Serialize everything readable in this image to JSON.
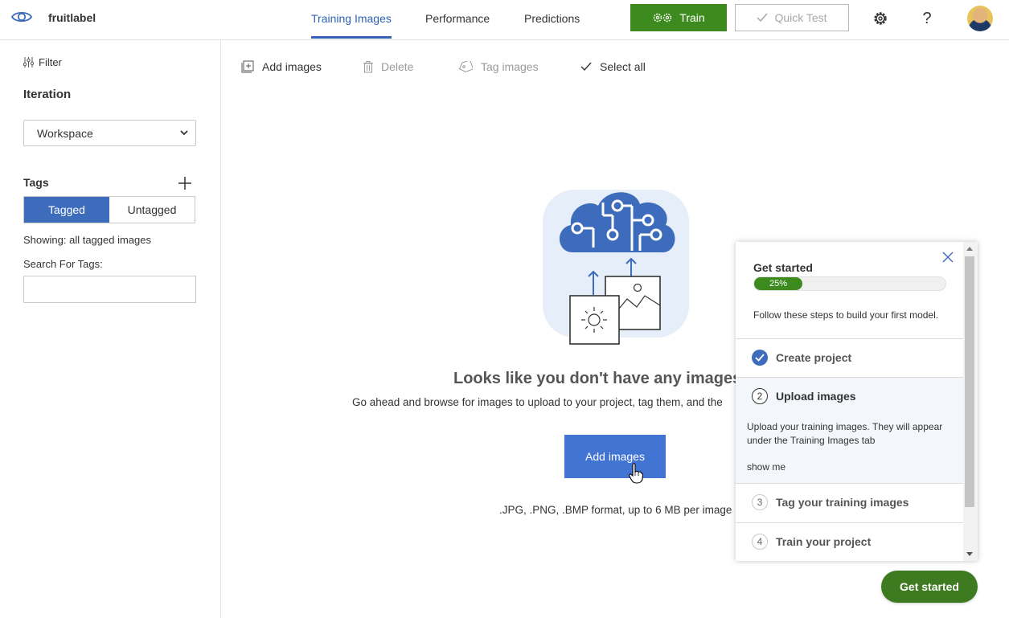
{
  "header": {
    "project_name": "fruitlabel",
    "tabs": [
      {
        "label": "Training Images",
        "active": true
      },
      {
        "label": "Performance",
        "active": false
      },
      {
        "label": "Predictions",
        "active": false
      }
    ],
    "train_label": "Train",
    "quick_test_label": "Quick Test",
    "help_label": "?"
  },
  "sidebar": {
    "filter_label": "Filter",
    "iteration_heading": "Iteration",
    "iteration_value": "Workspace",
    "tags_heading": "Tags",
    "tagged_label": "Tagged",
    "untagged_label": "Untagged",
    "showing_text": "Showing: all tagged images",
    "search_label": "Search For Tags:",
    "search_value": ""
  },
  "toolbar": {
    "add_images": "Add images",
    "delete": "Delete",
    "tag_images": "Tag images",
    "select_all": "Select all"
  },
  "empty_state": {
    "title": "Looks like you don't have any images",
    "subtitle": "Go ahead and browse for images to upload to your project, tag them, and the",
    "button_label": "Add images",
    "formats_note": ".JPG, .PNG, .BMP format, up to 6 MB per image"
  },
  "get_started_panel": {
    "title": "Get started",
    "progress_label": "25%",
    "progress_fraction": 0.25,
    "description": "Follow these steps to build your first model.",
    "steps": [
      {
        "number": "1",
        "label": "Create project",
        "status": "done"
      },
      {
        "number": "2",
        "label": "Upload images",
        "status": "current"
      },
      {
        "number": "3",
        "label": "Tag your training images",
        "status": "pending"
      },
      {
        "number": "4",
        "label": "Train your project",
        "status": "pending"
      }
    ],
    "current_step_text": "Upload your training images. They will appear under the Training Images tab",
    "show_me_label": "show me"
  },
  "get_started_button": "Get started",
  "colors": {
    "accent_blue": "#3d6cbd",
    "train_green": "#3d8b1f",
    "primary_button": "#4274d4"
  }
}
